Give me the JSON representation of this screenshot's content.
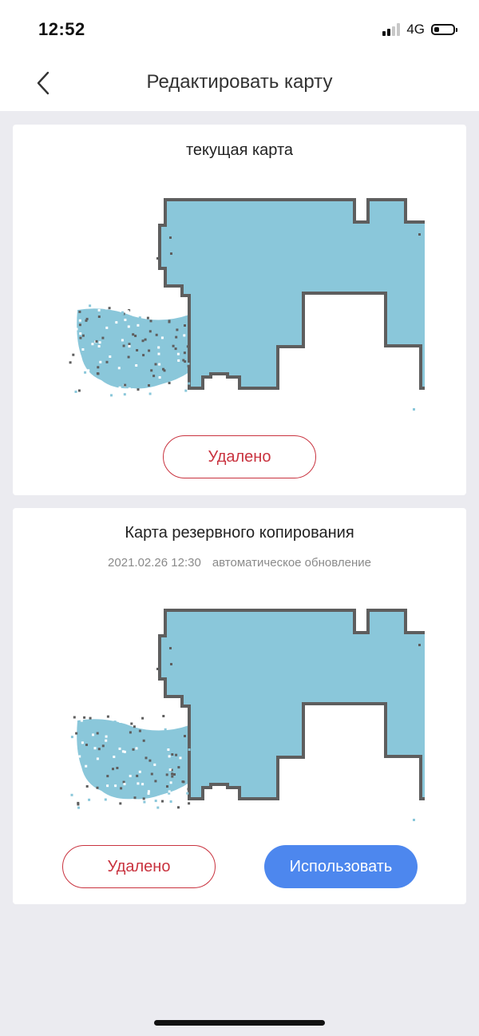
{
  "status_bar": {
    "time": "12:52",
    "network": "4G",
    "battery_level": 0.25
  },
  "header": {
    "title": "Редактировать карту"
  },
  "current_map": {
    "title": "текущая карта",
    "delete_label": "Удалено"
  },
  "backup_map": {
    "title": "Карта резервного копирования",
    "date": "2021.02.26 12:30",
    "update_type": "автоматическое обновление",
    "delete_label": "Удалено",
    "use_label": "Использовать"
  },
  "colors": {
    "map_floor": "#8ac7da",
    "map_wall": "#5e5e5e",
    "accent_red": "#c9333f",
    "accent_blue": "#4d87ee"
  },
  "icons": {
    "back": "chevron-left-icon"
  }
}
